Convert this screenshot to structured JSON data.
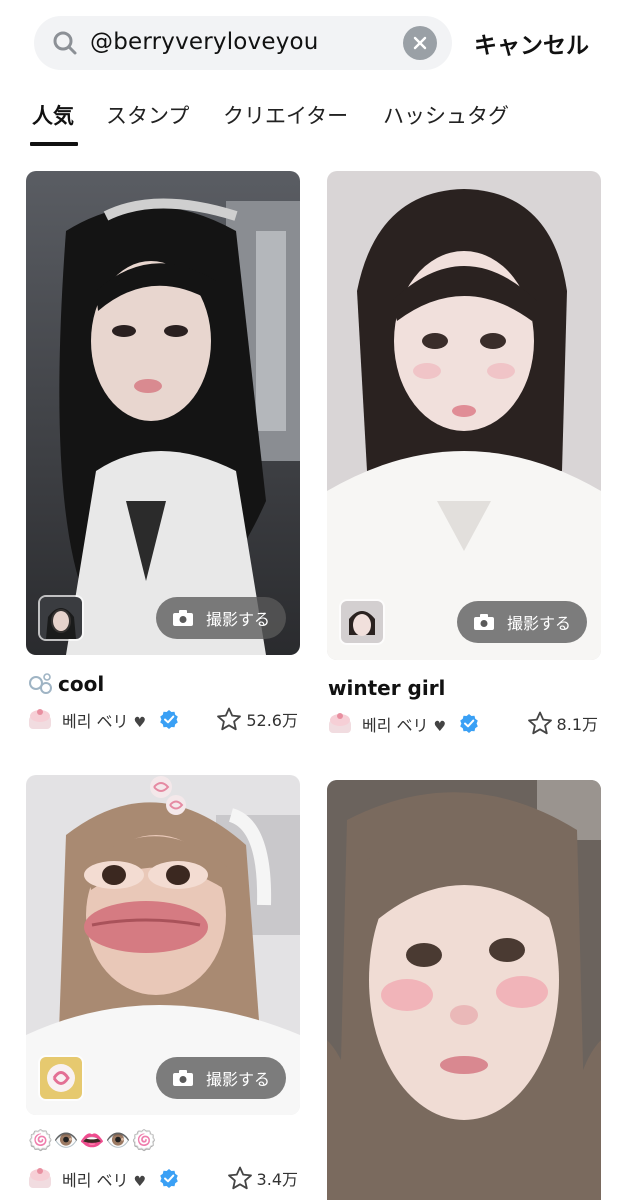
{
  "search": {
    "query": "@berryveryloveyou",
    "cancel_label": "キャンセル"
  },
  "tabs": [
    {
      "label": "人気",
      "active": true
    },
    {
      "label": "スタンプ",
      "active": false
    },
    {
      "label": "クリエイター",
      "active": false
    },
    {
      "label": "ハッシュタグ",
      "active": false
    }
  ],
  "cards": [
    {
      "title": "cool",
      "title_prefix_icon": "bubbles-icon",
      "creator": "베리 ベリ",
      "likes": "52.6万",
      "shoot_label": "撮影する"
    },
    {
      "title": "winter girl",
      "creator": "베리 ベリ",
      "likes": "8.1万",
      "shoot_label": "撮影する"
    },
    {
      "title": "🍥👁️👄👁️🍥",
      "creator": "베리 ベリ",
      "likes": "3.4万",
      "shoot_label": "撮影する"
    },
    {
      "title": "",
      "creator": "",
      "likes": "",
      "shoot_label": ""
    }
  ],
  "colors": {
    "search_bg": "#f2f3f5",
    "verified": "#3aa0f5",
    "shoot_btn": "#5a5a5a"
  }
}
